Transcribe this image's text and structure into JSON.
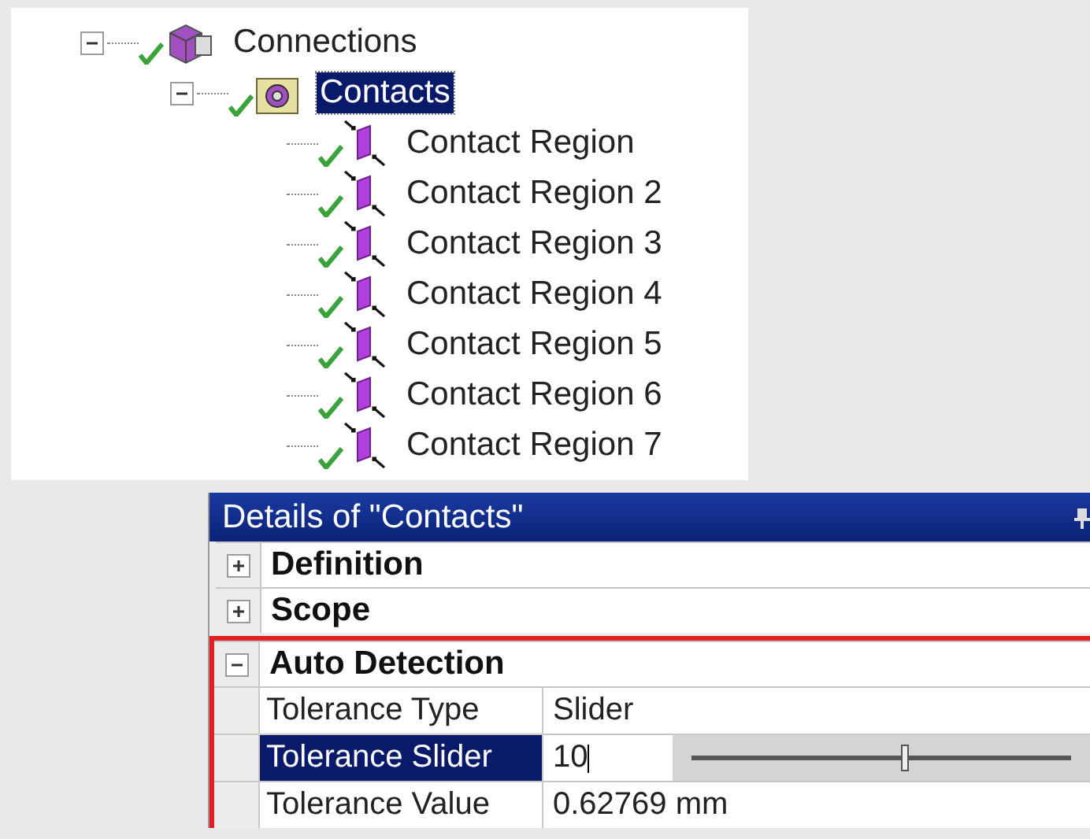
{
  "tree": {
    "items": [
      {
        "label": "Connections",
        "expanded": true,
        "checked": true,
        "selected": false,
        "kind": "connections",
        "children": [
          {
            "label": "Contacts",
            "expanded": true,
            "checked": true,
            "selected": true,
            "kind": "folder",
            "children": [
              {
                "label": "Contact Region",
                "checked": true,
                "selected": false,
                "kind": "contact"
              },
              {
                "label": "Contact Region 2",
                "checked": true,
                "selected": false,
                "kind": "contact"
              },
              {
                "label": "Contact Region 3",
                "checked": true,
                "selected": false,
                "kind": "contact"
              },
              {
                "label": "Contact Region 4",
                "checked": true,
                "selected": false,
                "kind": "contact"
              },
              {
                "label": "Contact Region 5",
                "checked": true,
                "selected": false,
                "kind": "contact"
              },
              {
                "label": "Contact Region 6",
                "checked": true,
                "selected": false,
                "kind": "contact"
              },
              {
                "label": "Contact Region 7",
                "checked": true,
                "selected": false,
                "kind": "contact"
              }
            ]
          }
        ]
      }
    ]
  },
  "details": {
    "title": "Details of \"Contacts\"",
    "sections": [
      {
        "label": "Definition",
        "expanded": false,
        "highlighted": false
      },
      {
        "label": "Scope",
        "expanded": false,
        "highlighted": false
      },
      {
        "label": "Auto Detection",
        "expanded": true,
        "highlighted": true,
        "rows": [
          {
            "kind": "text",
            "label": "Tolerance Type",
            "value": "Slider",
            "selected": false
          },
          {
            "kind": "slider",
            "label": "Tolerance Slider",
            "value": "10",
            "selected": true,
            "level": 0.56
          },
          {
            "kind": "text",
            "label": "Tolerance Value",
            "value": "0.62769 mm",
            "selected": false
          }
        ]
      }
    ]
  }
}
